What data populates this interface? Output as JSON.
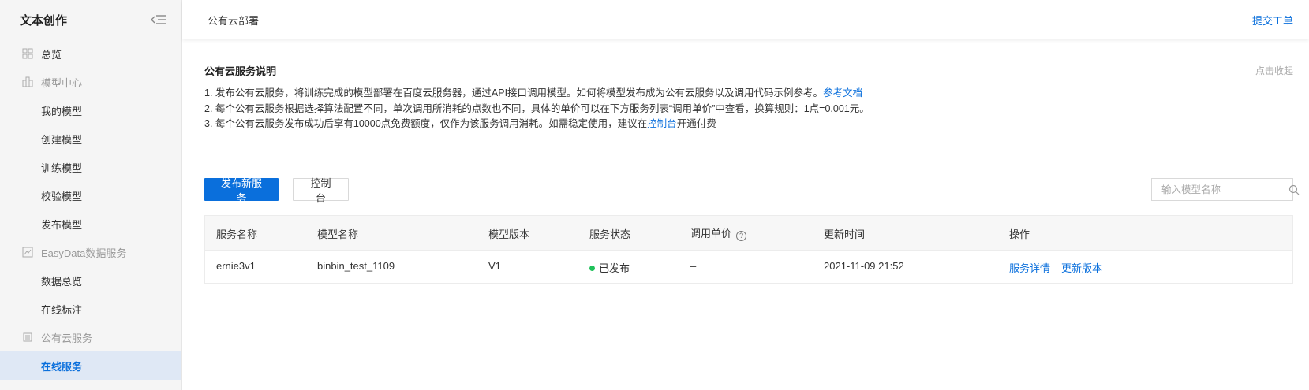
{
  "sidebar": {
    "title": "文本创作",
    "items": [
      {
        "label": "总览",
        "type": "top",
        "icon": "grid-icon"
      },
      {
        "label": "模型中心",
        "type": "group",
        "icon": "model-center-icon"
      },
      {
        "label": "我的模型",
        "type": "sub"
      },
      {
        "label": "创建模型",
        "type": "sub"
      },
      {
        "label": "训练模型",
        "type": "sub"
      },
      {
        "label": "校验模型",
        "type": "sub"
      },
      {
        "label": "发布模型",
        "type": "sub"
      },
      {
        "label": "EasyData数据服务",
        "type": "group",
        "icon": "chart-icon"
      },
      {
        "label": "数据总览",
        "type": "sub"
      },
      {
        "label": "在线标注",
        "type": "sub"
      },
      {
        "label": "公有云服务",
        "type": "group",
        "icon": "cloud-list-icon"
      },
      {
        "label": "在线服务",
        "type": "sub",
        "active": true
      }
    ]
  },
  "header": {
    "title": "公有云部署",
    "action": "提交工单"
  },
  "notice": {
    "title": "公有云服务说明",
    "toggle": "点击收起",
    "line1_text": "1. 发布公有云服务，将训练完成的模型部署在百度云服务器，通过API接口调用模型。如何将模型发布成为公有云服务以及调用代码示例参考。",
    "line1_link": "参考文档",
    "line2_text": "2. 每个公有云服务根据选择算法配置不同，单次调用所消耗的点数也不同，具体的单价可以在下方服务列表“调用单价”中查看，换算规则：1点=0.001元。",
    "line3_pre": "3. 每个公有云服务发布成功后享有10000点免费额度，仅作为该服务调用消耗。如需稳定使用，建议在",
    "line3_link": "控制台",
    "line3_post": "开通付费"
  },
  "toolbar": {
    "publish_label": "发布新服务",
    "console_label": "控制台",
    "search_placeholder": "输入模型名称"
  },
  "table": {
    "headers": [
      "服务名称",
      "模型名称",
      "模型版本",
      "服务状态",
      "调用单价",
      "更新时间",
      "操作"
    ],
    "rows": [
      {
        "service_name": "ernie3v1",
        "model_name": "binbin_test_1109",
        "version": "V1",
        "status": "已发布",
        "price": "–",
        "updated": "2021-11-09 21:52",
        "action_detail": "服务详情",
        "action_update": "更新版本"
      }
    ]
  },
  "colors": {
    "accent": "#0a6fdc",
    "status_published": "#1fc15a"
  }
}
